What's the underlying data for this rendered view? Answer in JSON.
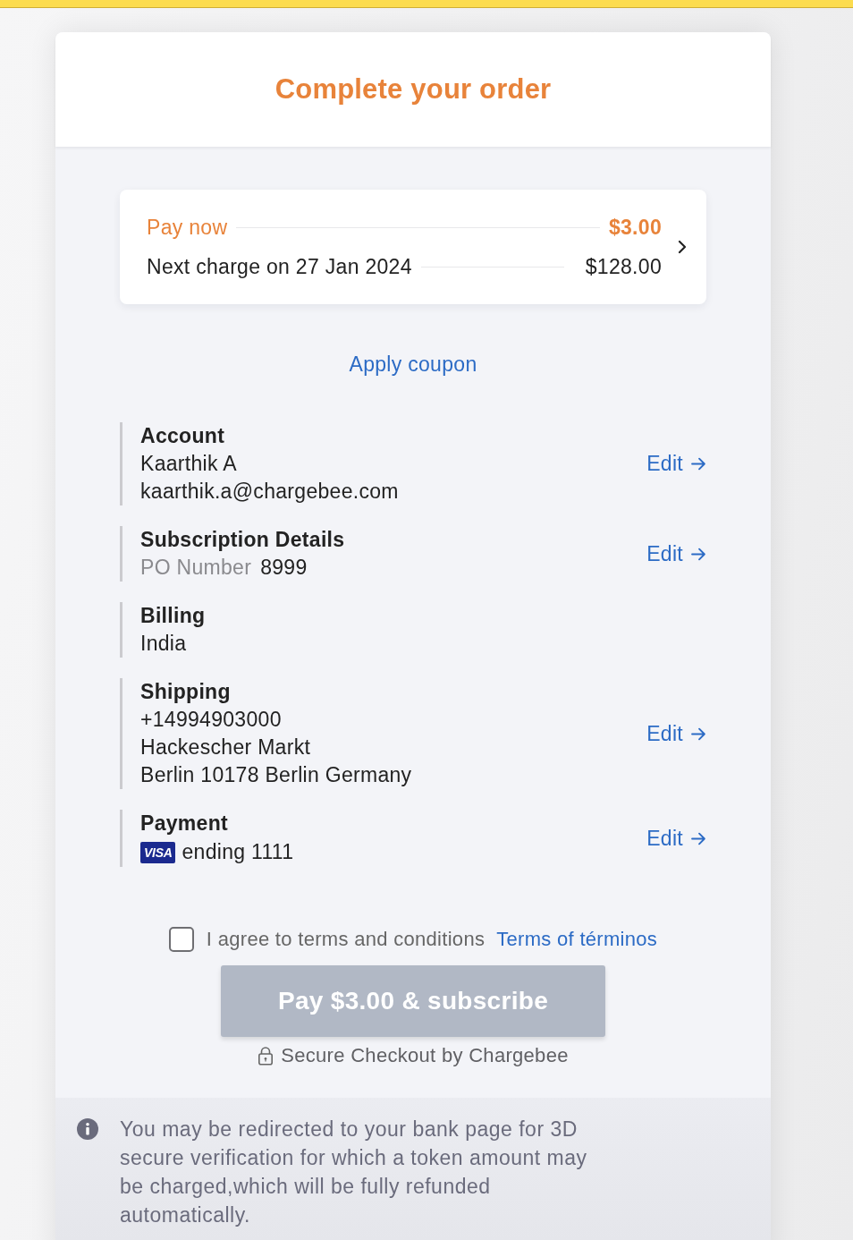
{
  "header": {
    "title": "Complete your order"
  },
  "summary": {
    "rows": [
      {
        "kind": "due",
        "label": "Pay now",
        "amount": "$3.00"
      },
      {
        "kind": "next",
        "label": "Next charge on 27 Jan 2024",
        "amount": "$128.00"
      }
    ]
  },
  "coupon": {
    "label": "Apply coupon"
  },
  "sections": [
    {
      "title": "Account",
      "lines": [
        {
          "kind": "text",
          "text": "Kaarthik A"
        },
        {
          "kind": "text",
          "text": "kaarthik.a@chargebee.com"
        }
      ],
      "edit": "Edit"
    },
    {
      "title": "Subscription Details",
      "lines": [
        {
          "kind": "field",
          "label": "PO Number",
          "value": "8999"
        }
      ],
      "edit": "Edit"
    },
    {
      "title": "Billing",
      "lines": [
        {
          "kind": "text",
          "text": "India"
        }
      ]
    },
    {
      "title": "Shipping",
      "lines": [
        {
          "kind": "text",
          "text": "+14994903000"
        },
        {
          "kind": "text",
          "text": "Hackescher Markt"
        },
        {
          "kind": "text",
          "text": "Berlin 10178 Berlin Germany"
        }
      ],
      "edit": "Edit"
    },
    {
      "title": "Payment",
      "lines": [
        {
          "kind": "card",
          "brand": "VISA",
          "text": "ending 1111"
        }
      ],
      "edit": "Edit"
    }
  ],
  "terms": {
    "checked": false,
    "label": "I agree to terms and conditions",
    "link": "Terms of términos"
  },
  "pay_button": {
    "label": "Pay $3.00 & subscribe",
    "disabled": true
  },
  "secure_note": {
    "label": "Secure Checkout by Chargebee"
  },
  "notice": {
    "text": "You may be redirected to your bank page for 3D secure verification for which a token amount may be charged,which will be fully refunded automatically."
  }
}
